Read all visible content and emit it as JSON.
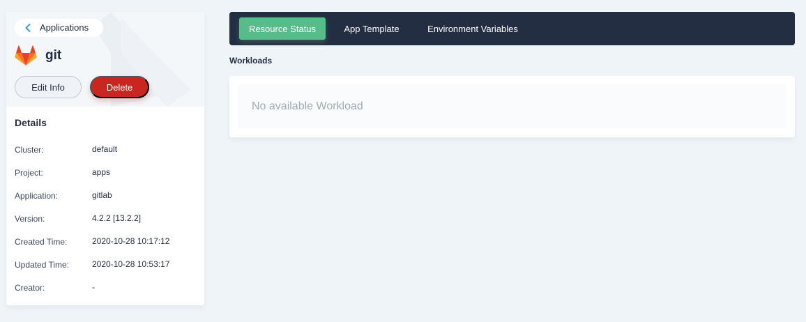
{
  "sidebar": {
    "back_label": "Applications",
    "app_name": "git",
    "edit_label": "Edit Info",
    "delete_label": "Delete",
    "details_title": "Details",
    "details": [
      {
        "label": "Cluster:",
        "value": "default"
      },
      {
        "label": "Project:",
        "value": "apps"
      },
      {
        "label": "Application:",
        "value": "gitlab"
      },
      {
        "label": "Version:",
        "value": "4.2.2 [13.2.2]"
      },
      {
        "label": "Created Time:",
        "value": "2020-10-28 10:17:12"
      },
      {
        "label": "Updated Time:",
        "value": "2020-10-28 10:53:17"
      },
      {
        "label": "Creator:",
        "value": "-"
      }
    ]
  },
  "tabs": [
    {
      "label": "Resource Status",
      "active": true
    },
    {
      "label": "App Template",
      "active": false
    },
    {
      "label": "Environment Variables",
      "active": false
    }
  ],
  "workloads": {
    "section_label": "Workloads",
    "empty_text": "No available Workload"
  },
  "colors": {
    "accent_green": "#55bc8a",
    "danger_red": "#ca2621",
    "tabbar_dark": "#242e42",
    "page_bg": "#eff4f9"
  },
  "icons": {
    "back": "chevron-left-icon",
    "logo": "gitlab-logo"
  }
}
